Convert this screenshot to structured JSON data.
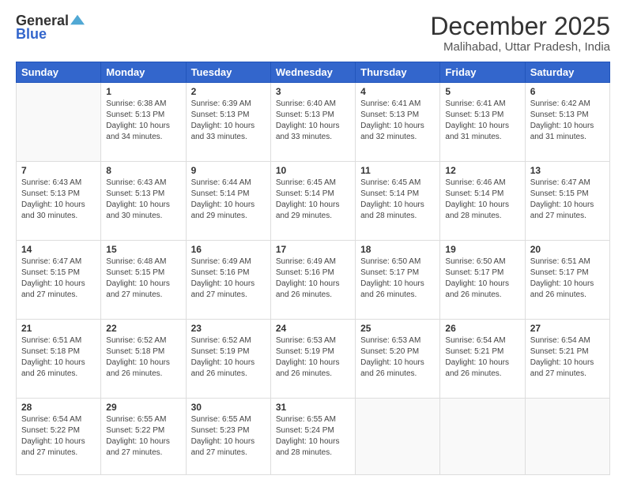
{
  "logo": {
    "general": "General",
    "blue": "Blue"
  },
  "header": {
    "month": "December 2025",
    "location": "Malihabad, Uttar Pradesh, India"
  },
  "days": [
    "Sunday",
    "Monday",
    "Tuesday",
    "Wednesday",
    "Thursday",
    "Friday",
    "Saturday"
  ],
  "weeks": [
    [
      {
        "day": "",
        "sunrise": "",
        "sunset": "",
        "daylight": ""
      },
      {
        "day": "1",
        "sunrise": "Sunrise: 6:38 AM",
        "sunset": "Sunset: 5:13 PM",
        "daylight": "Daylight: 10 hours and 34 minutes."
      },
      {
        "day": "2",
        "sunrise": "Sunrise: 6:39 AM",
        "sunset": "Sunset: 5:13 PM",
        "daylight": "Daylight: 10 hours and 33 minutes."
      },
      {
        "day": "3",
        "sunrise": "Sunrise: 6:40 AM",
        "sunset": "Sunset: 5:13 PM",
        "daylight": "Daylight: 10 hours and 33 minutes."
      },
      {
        "day": "4",
        "sunrise": "Sunrise: 6:41 AM",
        "sunset": "Sunset: 5:13 PM",
        "daylight": "Daylight: 10 hours and 32 minutes."
      },
      {
        "day": "5",
        "sunrise": "Sunrise: 6:41 AM",
        "sunset": "Sunset: 5:13 PM",
        "daylight": "Daylight: 10 hours and 31 minutes."
      },
      {
        "day": "6",
        "sunrise": "Sunrise: 6:42 AM",
        "sunset": "Sunset: 5:13 PM",
        "daylight": "Daylight: 10 hours and 31 minutes."
      }
    ],
    [
      {
        "day": "7",
        "sunrise": "Sunrise: 6:43 AM",
        "sunset": "Sunset: 5:13 PM",
        "daylight": "Daylight: 10 hours and 30 minutes."
      },
      {
        "day": "8",
        "sunrise": "Sunrise: 6:43 AM",
        "sunset": "Sunset: 5:13 PM",
        "daylight": "Daylight: 10 hours and 30 minutes."
      },
      {
        "day": "9",
        "sunrise": "Sunrise: 6:44 AM",
        "sunset": "Sunset: 5:14 PM",
        "daylight": "Daylight: 10 hours and 29 minutes."
      },
      {
        "day": "10",
        "sunrise": "Sunrise: 6:45 AM",
        "sunset": "Sunset: 5:14 PM",
        "daylight": "Daylight: 10 hours and 29 minutes."
      },
      {
        "day": "11",
        "sunrise": "Sunrise: 6:45 AM",
        "sunset": "Sunset: 5:14 PM",
        "daylight": "Daylight: 10 hours and 28 minutes."
      },
      {
        "day": "12",
        "sunrise": "Sunrise: 6:46 AM",
        "sunset": "Sunset: 5:14 PM",
        "daylight": "Daylight: 10 hours and 28 minutes."
      },
      {
        "day": "13",
        "sunrise": "Sunrise: 6:47 AM",
        "sunset": "Sunset: 5:15 PM",
        "daylight": "Daylight: 10 hours and 27 minutes."
      }
    ],
    [
      {
        "day": "14",
        "sunrise": "Sunrise: 6:47 AM",
        "sunset": "Sunset: 5:15 PM",
        "daylight": "Daylight: 10 hours and 27 minutes."
      },
      {
        "day": "15",
        "sunrise": "Sunrise: 6:48 AM",
        "sunset": "Sunset: 5:15 PM",
        "daylight": "Daylight: 10 hours and 27 minutes."
      },
      {
        "day": "16",
        "sunrise": "Sunrise: 6:49 AM",
        "sunset": "Sunset: 5:16 PM",
        "daylight": "Daylight: 10 hours and 27 minutes."
      },
      {
        "day": "17",
        "sunrise": "Sunrise: 6:49 AM",
        "sunset": "Sunset: 5:16 PM",
        "daylight": "Daylight: 10 hours and 26 minutes."
      },
      {
        "day": "18",
        "sunrise": "Sunrise: 6:50 AM",
        "sunset": "Sunset: 5:17 PM",
        "daylight": "Daylight: 10 hours and 26 minutes."
      },
      {
        "day": "19",
        "sunrise": "Sunrise: 6:50 AM",
        "sunset": "Sunset: 5:17 PM",
        "daylight": "Daylight: 10 hours and 26 minutes."
      },
      {
        "day": "20",
        "sunrise": "Sunrise: 6:51 AM",
        "sunset": "Sunset: 5:17 PM",
        "daylight": "Daylight: 10 hours and 26 minutes."
      }
    ],
    [
      {
        "day": "21",
        "sunrise": "Sunrise: 6:51 AM",
        "sunset": "Sunset: 5:18 PM",
        "daylight": "Daylight: 10 hours and 26 minutes."
      },
      {
        "day": "22",
        "sunrise": "Sunrise: 6:52 AM",
        "sunset": "Sunset: 5:18 PM",
        "daylight": "Daylight: 10 hours and 26 minutes."
      },
      {
        "day": "23",
        "sunrise": "Sunrise: 6:52 AM",
        "sunset": "Sunset: 5:19 PM",
        "daylight": "Daylight: 10 hours and 26 minutes."
      },
      {
        "day": "24",
        "sunrise": "Sunrise: 6:53 AM",
        "sunset": "Sunset: 5:19 PM",
        "daylight": "Daylight: 10 hours and 26 minutes."
      },
      {
        "day": "25",
        "sunrise": "Sunrise: 6:53 AM",
        "sunset": "Sunset: 5:20 PM",
        "daylight": "Daylight: 10 hours and 26 minutes."
      },
      {
        "day": "26",
        "sunrise": "Sunrise: 6:54 AM",
        "sunset": "Sunset: 5:21 PM",
        "daylight": "Daylight: 10 hours and 26 minutes."
      },
      {
        "day": "27",
        "sunrise": "Sunrise: 6:54 AM",
        "sunset": "Sunset: 5:21 PM",
        "daylight": "Daylight: 10 hours and 27 minutes."
      }
    ],
    [
      {
        "day": "28",
        "sunrise": "Sunrise: 6:54 AM",
        "sunset": "Sunset: 5:22 PM",
        "daylight": "Daylight: 10 hours and 27 minutes."
      },
      {
        "day": "29",
        "sunrise": "Sunrise: 6:55 AM",
        "sunset": "Sunset: 5:22 PM",
        "daylight": "Daylight: 10 hours and 27 minutes."
      },
      {
        "day": "30",
        "sunrise": "Sunrise: 6:55 AM",
        "sunset": "Sunset: 5:23 PM",
        "daylight": "Daylight: 10 hours and 27 minutes."
      },
      {
        "day": "31",
        "sunrise": "Sunrise: 6:55 AM",
        "sunset": "Sunset: 5:24 PM",
        "daylight": "Daylight: 10 hours and 28 minutes."
      },
      {
        "day": "",
        "sunrise": "",
        "sunset": "",
        "daylight": ""
      },
      {
        "day": "",
        "sunrise": "",
        "sunset": "",
        "daylight": ""
      },
      {
        "day": "",
        "sunrise": "",
        "sunset": "",
        "daylight": ""
      }
    ]
  ]
}
